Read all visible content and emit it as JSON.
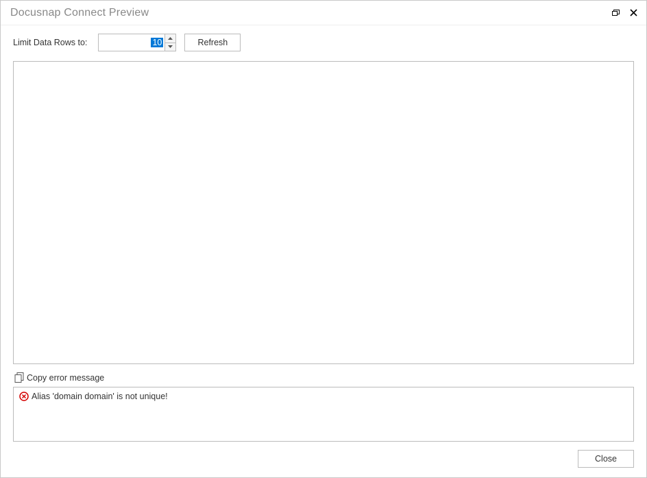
{
  "window": {
    "title": "Docusnap Connect Preview"
  },
  "controls": {
    "limit_label": "Limit Data Rows to:",
    "limit_value": "10",
    "refresh_label": "Refresh"
  },
  "copy": {
    "label": "Copy error message"
  },
  "error": {
    "message": "Alias 'domain domain' is not unique!"
  },
  "footer": {
    "close_label": "Close"
  }
}
